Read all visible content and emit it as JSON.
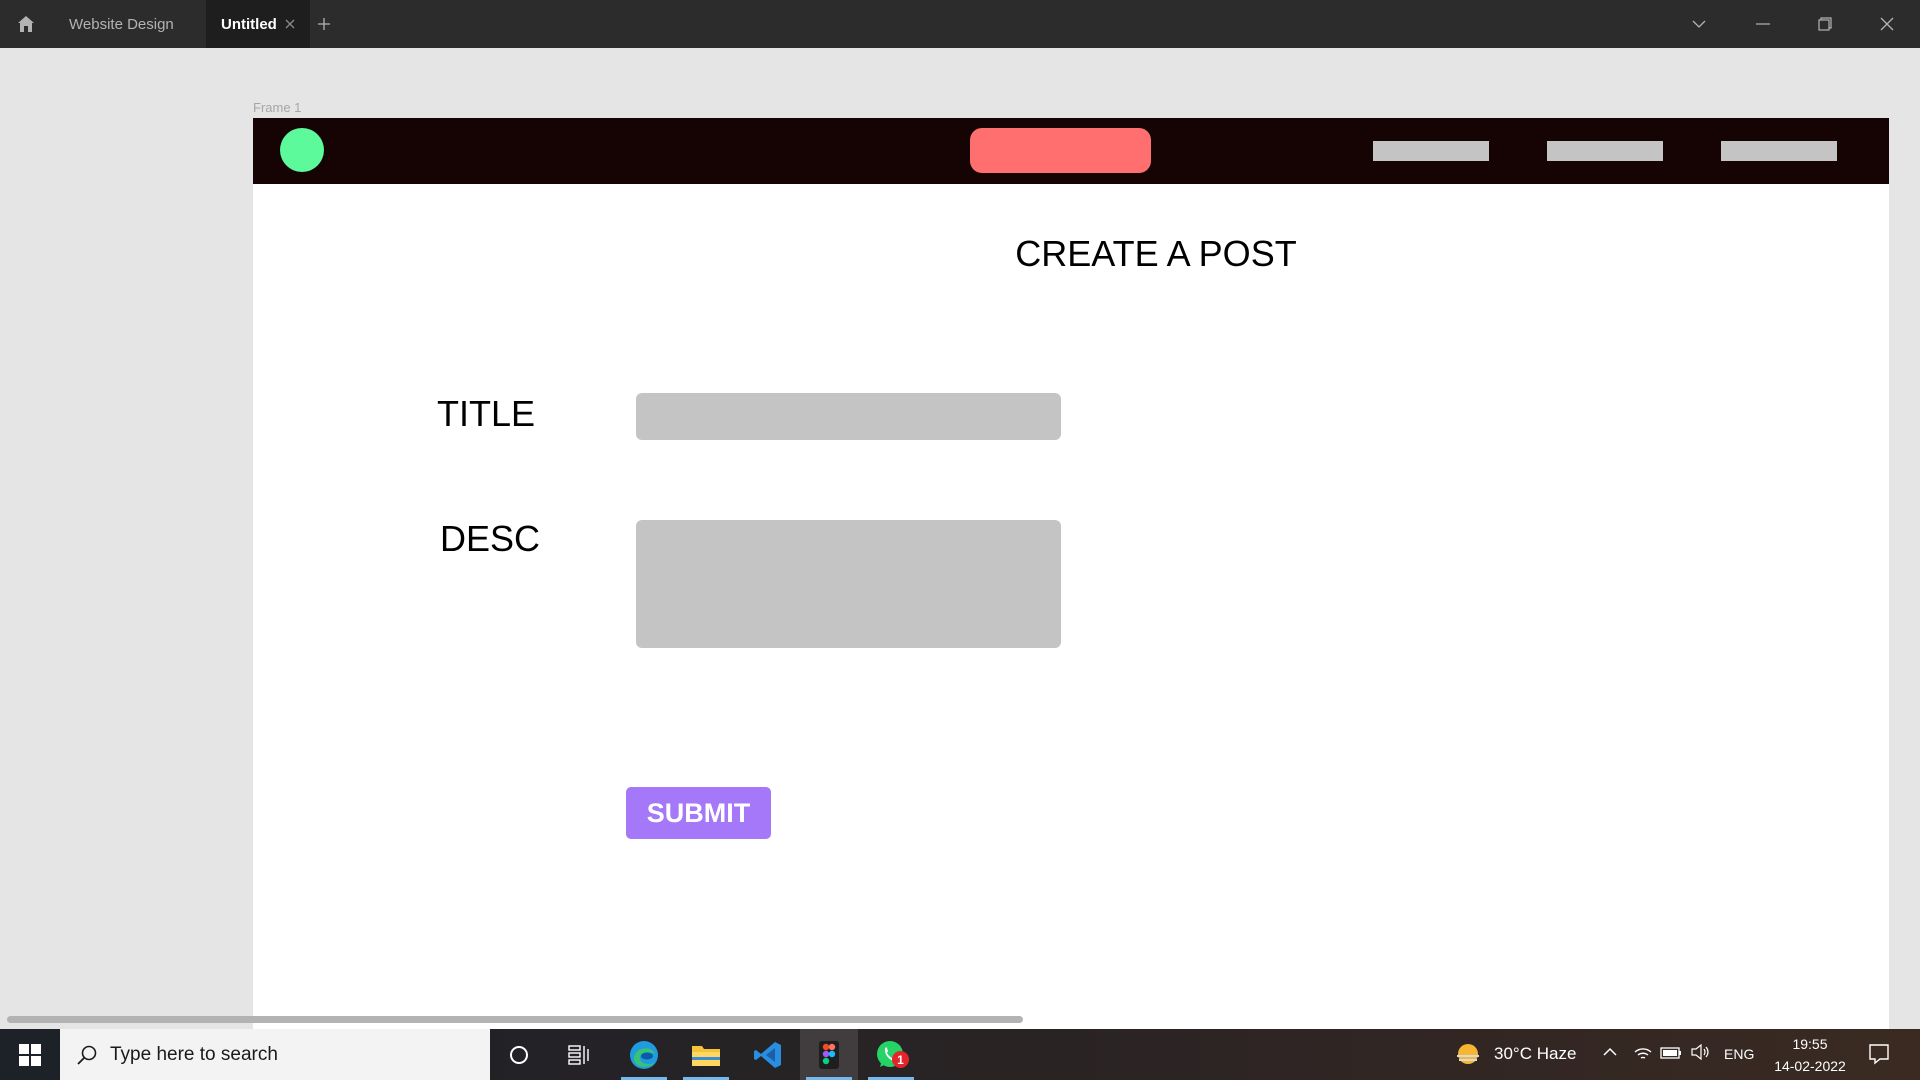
{
  "titlebar": {
    "home_icon": "home-icon",
    "tabs": [
      {
        "label": "Website Design"
      },
      {
        "label": "Untitled"
      }
    ]
  },
  "canvas": {
    "frame_label": "Frame 1",
    "heading": "CREATE A POST",
    "form": {
      "title_label": "TITLE",
      "desc_label": "DESC",
      "submit_label": "SUBMIT"
    },
    "colors": {
      "navbar": "#160303",
      "logo": "#5cfa9b",
      "nav_pill": "#ff6f6f",
      "nav_link": "#c4c4c4",
      "field": "#c4c4c4",
      "submit": "#a478f9"
    }
  },
  "taskbar": {
    "search_placeholder": "Type here to search",
    "weather": "30°C  Haze",
    "language": "ENG",
    "time": "19:55",
    "date": "14-02-2022",
    "whatsapp_badge": "1"
  }
}
